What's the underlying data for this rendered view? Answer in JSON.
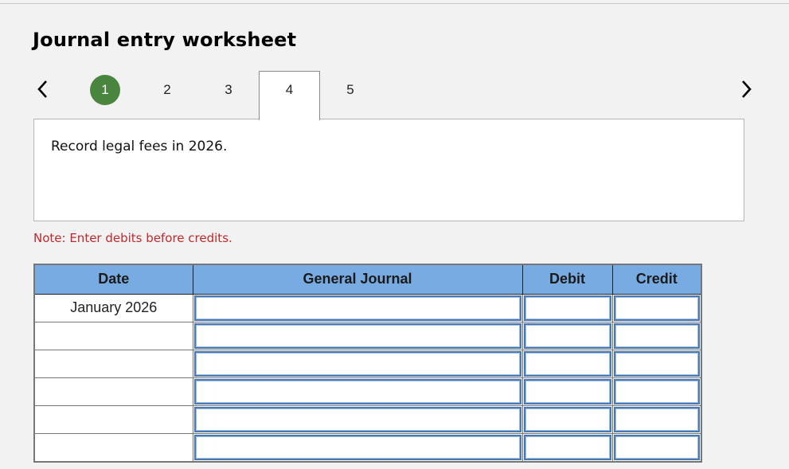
{
  "header": {
    "title": "Journal entry worksheet"
  },
  "navigation": {
    "prev_icon": "chevron-left-icon",
    "next_icon": "chevron-right-icon",
    "steps": [
      {
        "label": "1",
        "state": "completed"
      },
      {
        "label": "2",
        "state": "default"
      },
      {
        "label": "3",
        "state": "default"
      },
      {
        "label": "4",
        "state": "active"
      },
      {
        "label": "5",
        "state": "default"
      }
    ]
  },
  "prompt": {
    "text": "Record legal fees in 2026."
  },
  "note": {
    "text": "Note: Enter debits before credits."
  },
  "table": {
    "headers": [
      "Date",
      "General Journal",
      "Debit",
      "Credit"
    ],
    "rows": [
      {
        "date": "January 2026",
        "account": "",
        "debit": "",
        "credit": ""
      },
      {
        "date": "",
        "account": "",
        "debit": "",
        "credit": ""
      },
      {
        "date": "",
        "account": "",
        "debit": "",
        "credit": ""
      },
      {
        "date": "",
        "account": "",
        "debit": "",
        "credit": ""
      },
      {
        "date": "",
        "account": "",
        "debit": "",
        "credit": ""
      },
      {
        "date": "",
        "account": "",
        "debit": "",
        "credit": ""
      }
    ]
  },
  "colors": {
    "completed_step": "#4a8540",
    "header_bg": "#77abe2",
    "note_text": "#c0282c",
    "input_border": "#4a78b5"
  }
}
